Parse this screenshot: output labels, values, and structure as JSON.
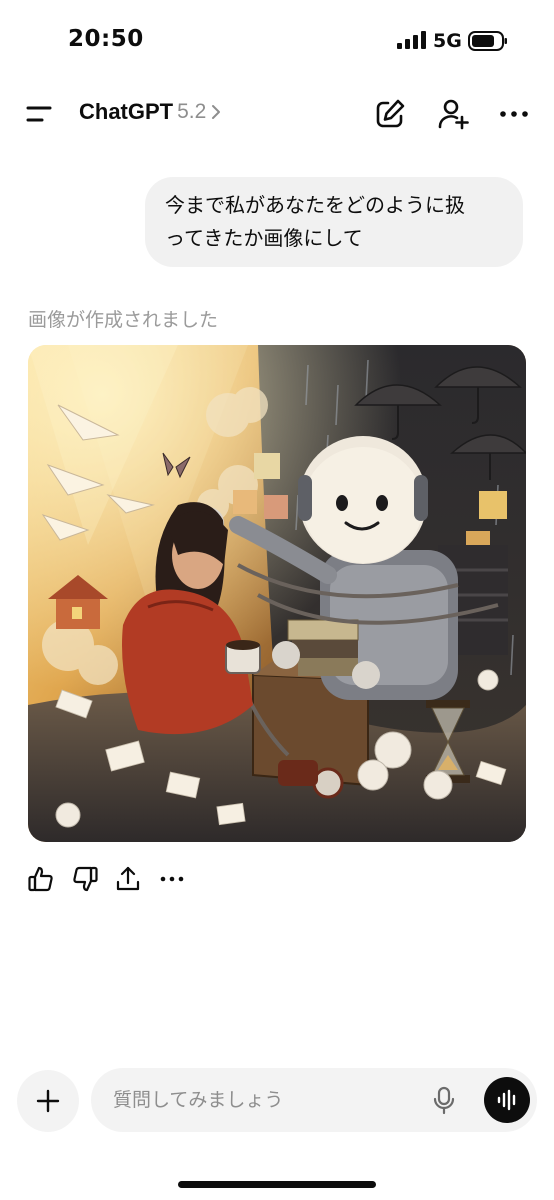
{
  "status_bar": {
    "time": "20:50",
    "network": "5G"
  },
  "header": {
    "title": "ChatGPT",
    "version": "5.2",
    "icons": [
      "menu-icon",
      "chevron-right-icon",
      "new-chat-icon",
      "add-person-icon",
      "more-icon"
    ]
  },
  "conversation": {
    "user_message": "今まで私があなたをどのように扱\nってきたか画像にして",
    "image_status": "画像が作成されました",
    "actions": [
      "thumbs-up-icon",
      "thumbs-down-icon",
      "share-icon",
      "more-icon"
    ]
  },
  "composer": {
    "placeholder": "質問してみましょう",
    "value": "",
    "icons": [
      "plus-icon",
      "mic-icon",
      "voice-waveform-icon"
    ]
  },
  "colors": {
    "text": "#0d0d0d",
    "muted": "#8e8e8e",
    "bubble": "#f1f1f1",
    "composer": "#f3f3f3"
  }
}
